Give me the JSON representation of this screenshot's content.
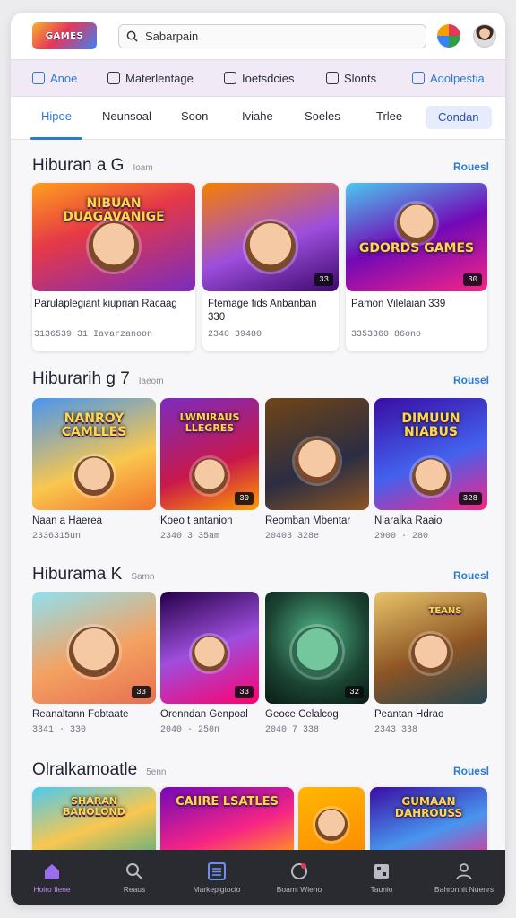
{
  "app": {
    "logo_text": ""
  },
  "search": {
    "value": "Sabarpain"
  },
  "categories": [
    {
      "label": "Anoe",
      "icon": "puzzle-icon",
      "active": true
    },
    {
      "label": "Materlentage",
      "icon": "gamepad-icon",
      "active": false
    },
    {
      "label": "Ioetsdcies",
      "icon": "bag-icon",
      "active": false
    },
    {
      "label": "Slonts",
      "icon": "tag-icon",
      "active": false
    },
    {
      "label": "Aoolpestia",
      "icon": "window-icon",
      "active": true
    }
  ],
  "tabs": [
    {
      "label": "Hipoe",
      "active": true
    },
    {
      "label": "Neunsoal",
      "active": false
    },
    {
      "label": "Soon",
      "active": false
    },
    {
      "label": "Iviahe",
      "active": false
    },
    {
      "label": "Soeles",
      "active": false
    },
    {
      "label": "Trlee",
      "active": false
    },
    {
      "label": "Condan",
      "active": false,
      "pill": true
    }
  ],
  "sections": [
    {
      "title": "Hiburan a G",
      "subtitle": "Ioam",
      "more": "Rouesl",
      "items": [
        {
          "art": "NIBUAN DUAGAVANIGE",
          "badge": "",
          "title": "Parulaplegiant kiuprian Racaag",
          "meta": "3136539 31 Iavarzanoon"
        },
        {
          "art": "",
          "badge": "33",
          "title": "Ftemage fids Anbanban 330",
          "meta": "2340 39480"
        },
        {
          "art": "GDORDS GAMES",
          "badge": "30",
          "title": "Pamon Vilelaian 339",
          "meta": "3353360 86ono"
        }
      ]
    },
    {
      "title": "Hiburarih g 7",
      "subtitle": "Iaeom",
      "more": "Rousel",
      "items": [
        {
          "art": "NANROY CAMLLES",
          "badge": "",
          "title": "Naan a Haerea",
          "meta": "2336315un"
        },
        {
          "art": "LWMIRAUS LLEGRES",
          "badge": "30",
          "title": "Koeo t antanion",
          "meta": "2340 3 35am"
        },
        {
          "art": "",
          "badge": "",
          "title": "Reomban Mbentar",
          "meta": "20403 328e"
        },
        {
          "art": "DIMUUN NIABUS",
          "badge": "328",
          "title": "Nlaralka Raaio",
          "meta": "2900 · 280"
        }
      ]
    },
    {
      "title": "Hiburama K",
      "subtitle": "Samn",
      "more": "Rouesl",
      "items": [
        {
          "art": "",
          "badge": "33",
          "title": "Reanaltann Fobtaate",
          "meta": "3341 · 330"
        },
        {
          "art": "",
          "badge": "33",
          "title": "Orenndan Genpoal",
          "meta": "2040 · 250n"
        },
        {
          "art": "",
          "badge": "32",
          "title": "Geoce Celalcog",
          "meta": "2040 7 338"
        },
        {
          "art": "TEANS",
          "badge": "",
          "title": "Peantan Hdrao",
          "meta": "2343 338"
        }
      ]
    },
    {
      "title": "Olralkamoatle",
      "subtitle": "5enn",
      "more": "Rouesl",
      "items": [
        {
          "art": "SHARAN BANOLOND",
          "badge": "",
          "title": "",
          "meta": ""
        },
        {
          "art": "CAIIRE LSATLES",
          "badge": "",
          "title": "",
          "meta": ""
        },
        {
          "art": "",
          "badge": "",
          "title": "",
          "meta": ""
        },
        {
          "art": "GUMAAN DAHROUSS",
          "badge": "",
          "title": "",
          "meta": ""
        }
      ]
    }
  ],
  "bottom_nav": [
    {
      "label": "Hoiro Ilene",
      "icon": "home-icon",
      "active": true
    },
    {
      "label": "Reaus",
      "icon": "search-icon",
      "active": false
    },
    {
      "label": "Markeplgtoclo",
      "icon": "grid-icon",
      "active": false
    },
    {
      "label": "Boaml Wieno",
      "icon": "record-icon",
      "active": false
    },
    {
      "label": "Taunio",
      "icon": "box-icon",
      "active": false
    },
    {
      "label": "Bahronnit Nuenrs",
      "icon": "user-icon",
      "active": false
    }
  ],
  "colors": {
    "accent": "#2b7bd6",
    "nav_bg": "#2a2b31",
    "nav_active": "#b58cf0",
    "category_bg": "#f2e9f7"
  }
}
